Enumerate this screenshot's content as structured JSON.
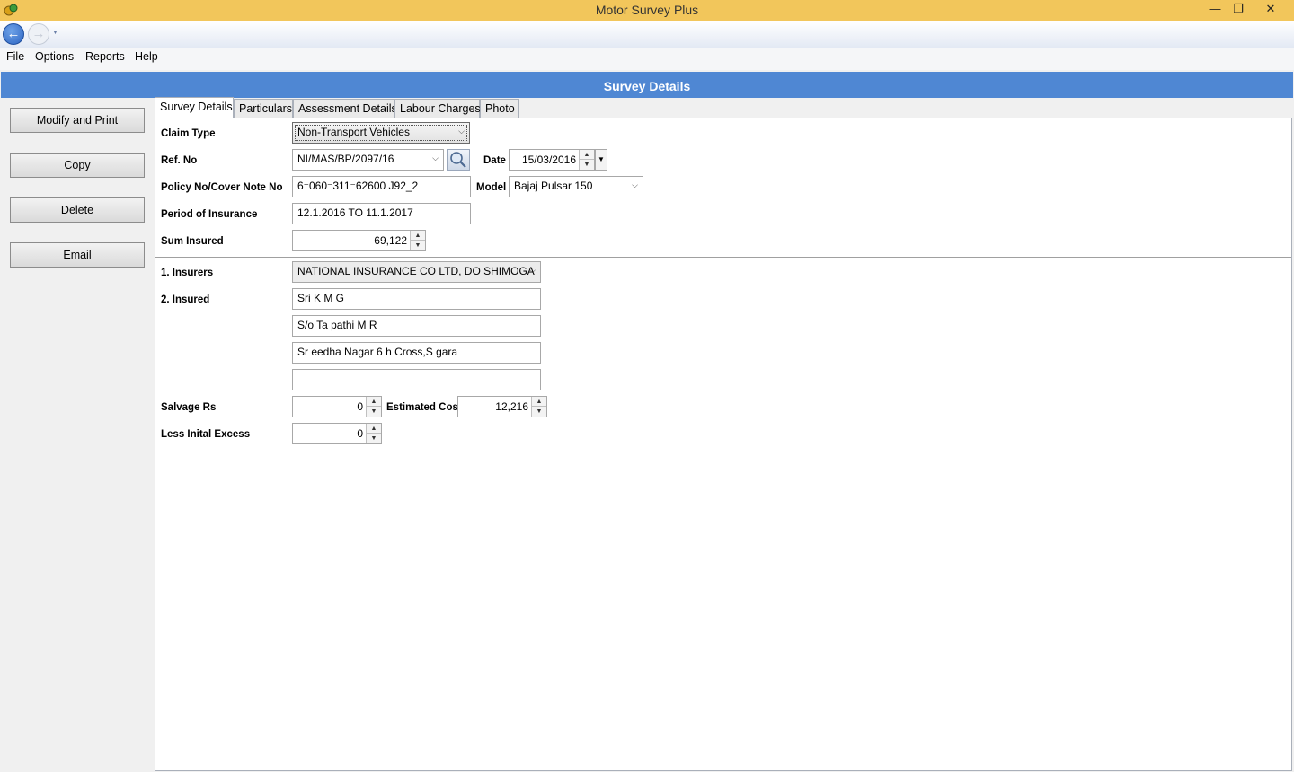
{
  "window": {
    "title": "Motor Survey Plus",
    "minimize": "—",
    "restore": "❐",
    "close": "✕"
  },
  "menu": {
    "file": "File",
    "options": "Options",
    "reports": "Reports",
    "help": "Help"
  },
  "header": {
    "title": "Survey Details"
  },
  "actions": {
    "modify_print": "Modify and Print",
    "copy": "Copy",
    "delete": "Delete",
    "email": "Email"
  },
  "tabs": [
    {
      "label": "Survey Details"
    },
    {
      "label": "Particulars"
    },
    {
      "label": "Assessment Details"
    },
    {
      "label": "Labour Charges"
    },
    {
      "label": "Photo"
    }
  ],
  "form": {
    "claim_type": {
      "label": "Claim Type",
      "value": "Non-Transport Vehicles"
    },
    "ref_no": {
      "label": "Ref. No",
      "value": "NI/MAS/BP/2097/16"
    },
    "date": {
      "label": "Date",
      "value": "15/03/2016"
    },
    "policy_no": {
      "label": "Policy No/Cover Note No",
      "value": "6⁻060⁻311⁻62600 J92_2"
    },
    "model": {
      "label": "Model",
      "value": "Bajaj Pulsar 150"
    },
    "period": {
      "label": "Period of Insurance",
      "value": "12.1.2016 TO 11.1.2017"
    },
    "sum_insured": {
      "label": "Sum Insured",
      "value": "69,122"
    },
    "insurers": {
      "label": "1. Insurers",
      "value": "NATIONAL INSURANCE CO LTD, DO SHIMOGA"
    },
    "insured": {
      "label": "2. Insured",
      "line1": "Sri          K     M G",
      "line2": "S/o Ta  pathi M R",
      "line3": "Sr  eedha   Nagar   6 h Cross,S gara",
      "line4": ""
    },
    "salvage": {
      "label": "Salvage Rs",
      "value": "0"
    },
    "estimated_cost": {
      "label": "Estimated Cost",
      "value": "12,216"
    },
    "initial_excess": {
      "label": "Less Inital Excess",
      "value": "0"
    }
  },
  "icons": {
    "app": "app-logo-icon",
    "back": "back-arrow-icon",
    "forward": "forward-arrow-icon",
    "search": "magnifier-icon"
  }
}
